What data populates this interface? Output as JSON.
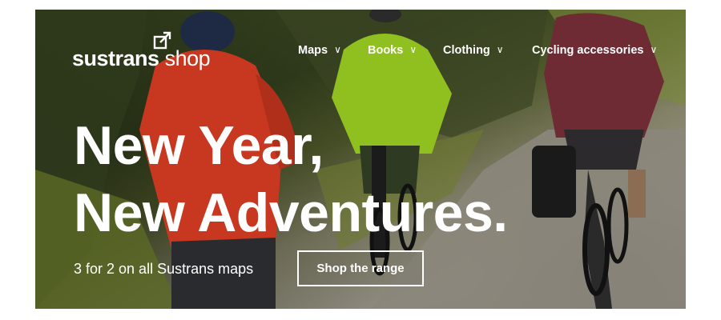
{
  "brand": {
    "logo_bold": "sustrans",
    "logo_light": " shop"
  },
  "nav": {
    "items": [
      {
        "label": "Maps"
      },
      {
        "label": "Books"
      },
      {
        "label": "Clothing"
      },
      {
        "label": "Cycling accessories"
      }
    ],
    "chevron_icon": "chevron-down-icon"
  },
  "hero": {
    "headline_line1": "New Year,",
    "headline_line2": "New Adventures.",
    "promo_text": "3 for 2 on all Sustrans maps",
    "cta_label": "Shop the range"
  },
  "colors": {
    "text": "#ffffff",
    "cyclist_left_jacket": "#c8371f",
    "cyclist_middle_jacket": "#8fc020",
    "cyclist_right_jacket": "#6e2b34"
  }
}
